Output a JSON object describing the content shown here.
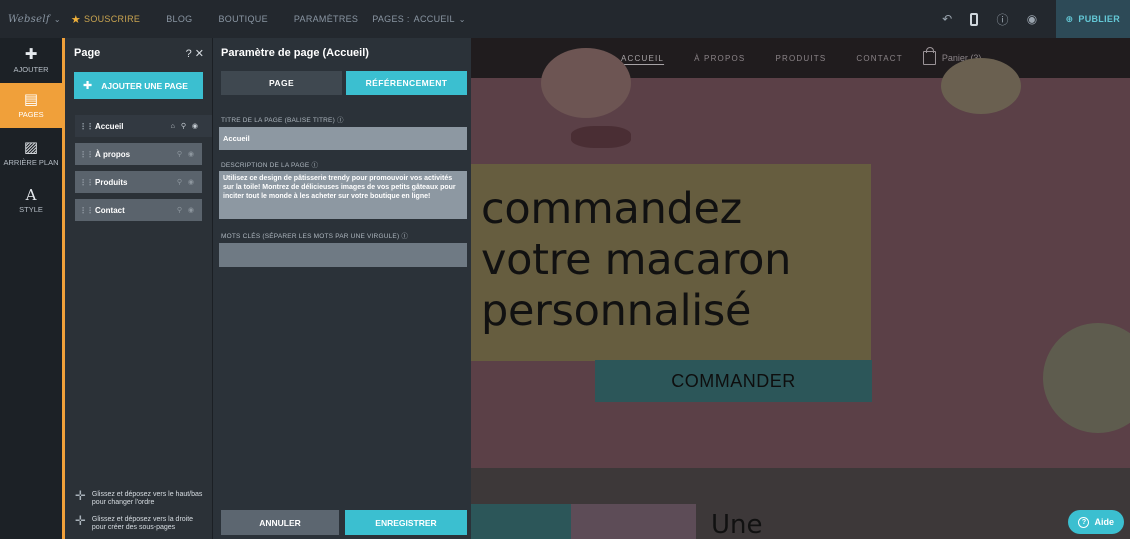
{
  "topbar": {
    "logo": "Webself",
    "subscribe": "SOUSCRIRE",
    "nav": [
      "BLOG",
      "BOUTIQUE",
      "PARAMÈTRES"
    ],
    "pages_label": "PAGES :",
    "current_page": "ACCUEIL",
    "publish": "PUBLIER"
  },
  "rail": {
    "items": [
      {
        "label": "AJOUTER",
        "icon": "plus-icon",
        "glyph": "✚"
      },
      {
        "label": "PAGES",
        "icon": "pages-icon",
        "glyph": "▤"
      },
      {
        "label": "ARRIÈRE PLAN",
        "icon": "image-icon",
        "glyph": "▨"
      },
      {
        "label": "STYLE",
        "icon": "font-style-icon",
        "glyph": "A"
      }
    ]
  },
  "page_panel": {
    "title": "Page",
    "help": "?",
    "close": "✕",
    "add_page": "AJOUTER UNE PAGE",
    "pages": [
      {
        "label": "Accueil",
        "active": true
      },
      {
        "label": "À propos"
      },
      {
        "label": "Produits"
      },
      {
        "label": "Contact"
      }
    ],
    "hint_1": "Glissez et déposez vers le haut/bas pour changer l'ordre",
    "hint_2": "Glissez et déposez vers la droite pour créer des sous-pages"
  },
  "settings": {
    "title": "Paramètre de page (Accueil)",
    "tabs": {
      "page": "PAGE",
      "seo": "RÉFÉRENCEMENT"
    },
    "title_label": "TITRE DE LA PAGE (BALISE TITRE) ⓘ",
    "title_value": "Accueil",
    "desc_label": "DESCRIPTION DE LA PAGE ⓘ",
    "desc_value": "Utilisez ce design de pâtisserie trendy pour promouvoir vos activités sur la toile! Montrez de délicieuses images de vos petits gâteaux pour inciter tout le monde à les acheter sur votre boutique en ligne!",
    "keywords_label": "MOTS CLÉS (SÉPARER LES MOTS PAR UNE VIRGULE) ⓘ",
    "keywords_value": "",
    "cancel": "ANNULER",
    "save": "ENREGISTRER"
  },
  "preview": {
    "nav": [
      "ACCUEIL",
      "À PROPOS",
      "PRODUITS",
      "CONTACT"
    ],
    "cart": "Panier (3)",
    "headline_1": "commandez",
    "headline_2": "votre macaron",
    "headline_3": "personnalisé",
    "cta": "COMMANDER",
    "section_title": "Une"
  },
  "help": "Aide",
  "colors": {
    "accent": "#3bbfd0",
    "active_rail": "#f0a03a",
    "panel_bg": "#2b3137"
  }
}
